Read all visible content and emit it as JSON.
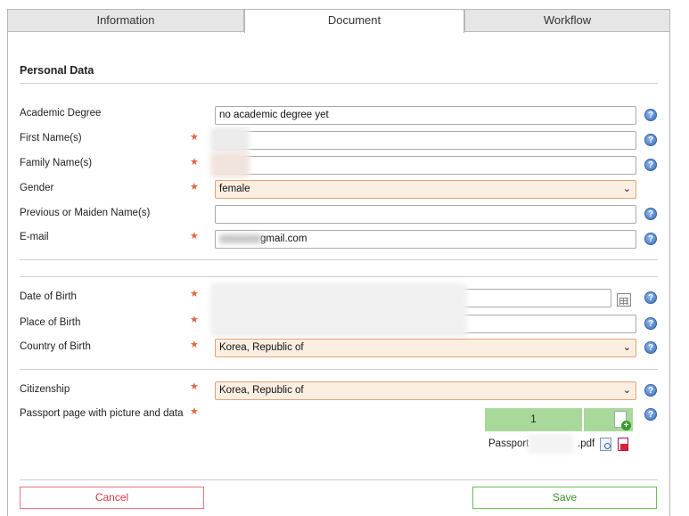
{
  "tabs": [
    {
      "label": "Information",
      "active": false
    },
    {
      "label": "Document",
      "active": true
    },
    {
      "label": "Workflow",
      "active": false
    }
  ],
  "section_title": "Personal Data",
  "fields": {
    "academic_degree": {
      "label": "Academic Degree",
      "value": "no academic degree yet",
      "required": false
    },
    "first_name": {
      "label": "First Name(s)",
      "value": "",
      "required": true
    },
    "family_name": {
      "label": "Family Name(s)",
      "value": "",
      "required": true
    },
    "gender": {
      "label": "Gender",
      "value": "female",
      "required": true
    },
    "previous_name": {
      "label": "Previous or Maiden Name(s)",
      "value": "",
      "required": false
    },
    "email": {
      "label": "E-mail",
      "value": "gmail.com",
      "required": true
    },
    "date_of_birth": {
      "label": "Date of Birth",
      "value": "",
      "required": true
    },
    "place_of_birth": {
      "label": "Place of Birth",
      "value": "",
      "required": true
    },
    "country_of_birth": {
      "label": "Country of Birth",
      "value": "Korea, Republic of",
      "required": true
    },
    "citizenship": {
      "label": "Citizenship",
      "value": "Korea, Republic of",
      "required": true
    },
    "passport": {
      "label": "Passport page with picture and data",
      "required": true,
      "file_count": "1",
      "file_name_start": "Passport",
      "file_ext": ".pdf"
    }
  },
  "icons": {
    "help": "question-mark",
    "required": "star",
    "dropdown": "chevron-down",
    "calendar": "calendar-grid",
    "add_file": "document-plus",
    "view_file": "document-magnifier",
    "delete_file": "document-delete"
  },
  "help_glyph": "?",
  "required_glyph": "★",
  "chevron_glyph": "⌄",
  "buttons": {
    "cancel": "Cancel",
    "save": "Save"
  },
  "colors": {
    "required": "#e2663d",
    "select_bg": "#fdeee2",
    "select_border": "#e0a37a",
    "upload_bg": "#a9d99a",
    "cancel": "#d23b45",
    "save": "#3a8f2a",
    "help": "#3b6fbf"
  }
}
